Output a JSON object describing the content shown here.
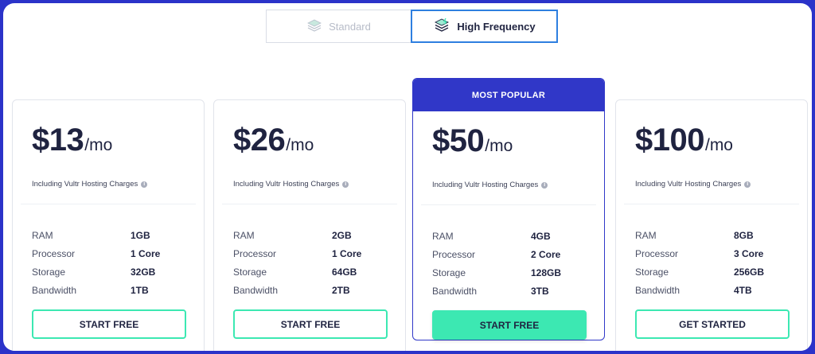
{
  "toggle": {
    "standard_label": "Standard",
    "high_frequency_label": "High Frequency",
    "active": "High Frequency"
  },
  "plans": [
    {
      "price": "$13",
      "period": "/mo",
      "note": "Including Vultr Hosting Charges",
      "specs": [
        {
          "label": "RAM",
          "value": "1GB"
        },
        {
          "label": "Processor",
          "value": "1 Core"
        },
        {
          "label": "Storage",
          "value": "32GB"
        },
        {
          "label": "Bandwidth",
          "value": "1TB"
        }
      ],
      "cta": "START FREE"
    },
    {
      "price": "$26",
      "period": "/mo",
      "note": "Including Vultr Hosting Charges",
      "specs": [
        {
          "label": "RAM",
          "value": "2GB"
        },
        {
          "label": "Processor",
          "value": "1 Core"
        },
        {
          "label": "Storage",
          "value": "64GB"
        },
        {
          "label": "Bandwidth",
          "value": "2TB"
        }
      ],
      "cta": "START FREE"
    },
    {
      "badge": "MOST POPULAR",
      "price": "$50",
      "period": "/mo",
      "note": "Including Vultr Hosting Charges",
      "specs": [
        {
          "label": "RAM",
          "value": "4GB"
        },
        {
          "label": "Processor",
          "value": "2 Core"
        },
        {
          "label": "Storage",
          "value": "128GB"
        },
        {
          "label": "Bandwidth",
          "value": "3TB"
        }
      ],
      "cta": "START FREE"
    },
    {
      "price": "$100",
      "period": "/mo",
      "note": "Including Vultr Hosting Charges",
      "specs": [
        {
          "label": "RAM",
          "value": "8GB"
        },
        {
          "label": "Processor",
          "value": "3 Core"
        },
        {
          "label": "Storage",
          "value": "256GB"
        },
        {
          "label": "Bandwidth",
          "value": "4TB"
        }
      ],
      "cta": "GET STARTED"
    }
  ],
  "colors": {
    "brand": "#3037c8",
    "accent": "#3ce8b2",
    "frame": "#2b33c9",
    "tab_active_border": "#2e7fe0"
  },
  "icons": {
    "standard": "server-stack-icon",
    "high_frequency": "server-stack-bolt-icon",
    "info": "info-icon"
  }
}
